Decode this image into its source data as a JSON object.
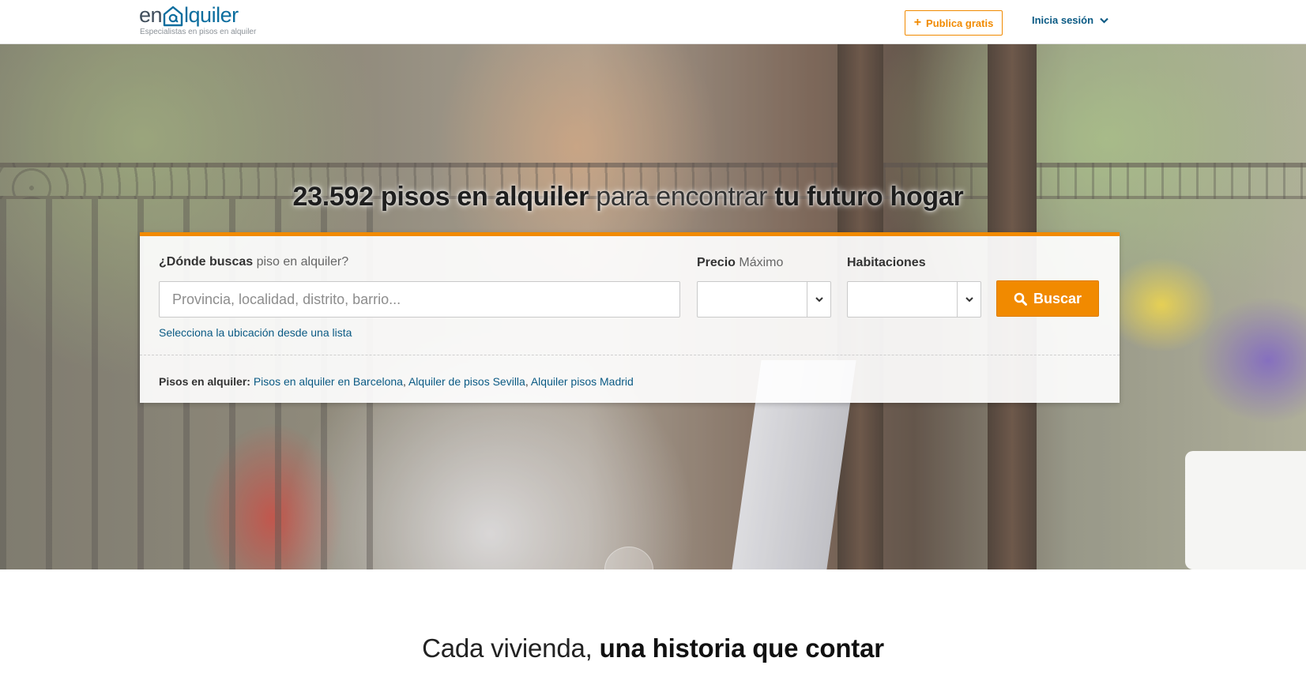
{
  "header": {
    "logo_en": "en",
    "logo_quiler": "lquiler",
    "logo_tagline": "Especialistas en pisos en alquiler",
    "publish_label": "Publica gratis",
    "login_label": "Inicia sesión"
  },
  "hero": {
    "headline_count": "23.592 pisos en alquiler",
    "headline_mid": " para encontrar ",
    "headline_end": "tu futuro hogar"
  },
  "search": {
    "where_bold": "¿Dónde buscas",
    "where_light": " piso en alquiler?",
    "location_placeholder": "Provincia, localidad, distrito, barrio...",
    "price_bold": "Precio",
    "price_light": " Máximo",
    "price_value": "",
    "rooms_label": "Habitaciones",
    "rooms_value": "",
    "search_button": "Buscar",
    "select_list_link": "Selecciona la ubicación desde una lista",
    "quick_label": "Pisos en alquiler:",
    "quick_links": [
      "Pisos en alquiler en Barcelona",
      "Alquiler de pisos Sevilla",
      "Alquiler pisos Madrid"
    ],
    "quick_sep": ", "
  },
  "story": {
    "light": "Cada vivienda, ",
    "bold": "una historia que contar"
  },
  "colors": {
    "accent": "#f18a00",
    "link": "#0a5a84",
    "logo_blue": "#0a6d9e"
  },
  "icons": [
    "plus-icon",
    "chevron-down-icon",
    "search-icon",
    "house-at-icon"
  ]
}
